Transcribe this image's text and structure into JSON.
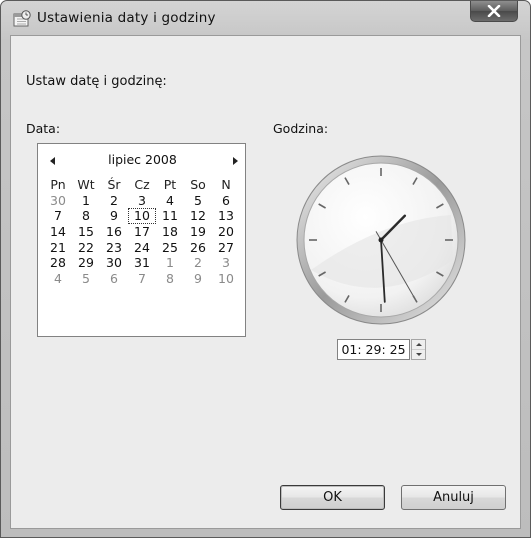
{
  "window": {
    "title": "Ustawienia daty i godziny"
  },
  "heading": "Ustaw datę i godzinę:",
  "labels": {
    "date": "Data:",
    "time": "Godzina:"
  },
  "calendar": {
    "month_label": "lipiec 2008",
    "weekdays": [
      "Pn",
      "Wt",
      "Śr",
      "Cz",
      "Pt",
      "So",
      "N"
    ],
    "weeks": [
      [
        {
          "d": "30",
          "o": true
        },
        {
          "d": "1"
        },
        {
          "d": "2"
        },
        {
          "d": "3"
        },
        {
          "d": "4"
        },
        {
          "d": "5"
        },
        {
          "d": "6"
        }
      ],
      [
        {
          "d": "7"
        },
        {
          "d": "8"
        },
        {
          "d": "9"
        },
        {
          "d": "10",
          "today": true
        },
        {
          "d": "11"
        },
        {
          "d": "12"
        },
        {
          "d": "13"
        }
      ],
      [
        {
          "d": "14"
        },
        {
          "d": "15"
        },
        {
          "d": "16"
        },
        {
          "d": "17"
        },
        {
          "d": "18"
        },
        {
          "d": "19"
        },
        {
          "d": "20"
        }
      ],
      [
        {
          "d": "21"
        },
        {
          "d": "22"
        },
        {
          "d": "23"
        },
        {
          "d": "24"
        },
        {
          "d": "25"
        },
        {
          "d": "26"
        },
        {
          "d": "27"
        }
      ],
      [
        {
          "d": "28"
        },
        {
          "d": "29"
        },
        {
          "d": "30"
        },
        {
          "d": "31"
        },
        {
          "d": "1",
          "o": true
        },
        {
          "d": "2",
          "o": true
        },
        {
          "d": "3",
          "o": true
        }
      ],
      [
        {
          "d": "4",
          "o": true
        },
        {
          "d": "5",
          "o": true
        },
        {
          "d": "6",
          "o": true
        },
        {
          "d": "7",
          "o": true
        },
        {
          "d": "8",
          "o": true
        },
        {
          "d": "9",
          "o": true
        },
        {
          "d": "10",
          "o": true
        }
      ]
    ]
  },
  "clock": {
    "hours": 1,
    "minutes": 29,
    "seconds": 25
  },
  "time_field": {
    "value": "01: 29: 25"
  },
  "buttons": {
    "ok": "OK",
    "cancel": "Anuluj"
  },
  "icons": {
    "title": "date-time-settings-icon",
    "close": "close-icon"
  }
}
